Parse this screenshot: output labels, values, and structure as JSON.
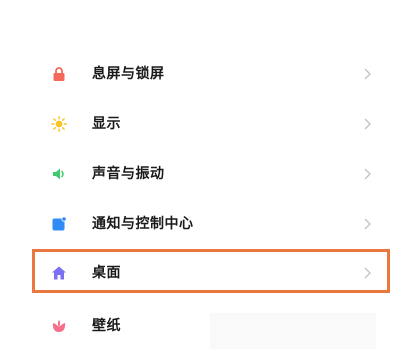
{
  "settings": {
    "items": [
      {
        "label": "息屏与锁屏",
        "icon": "lock-icon",
        "color": "#f4685a"
      },
      {
        "label": "显示",
        "icon": "sun-icon",
        "color": "#f9c425"
      },
      {
        "label": "声音与振动",
        "icon": "speaker-icon",
        "color": "#3ecb6f"
      },
      {
        "label": "通知与控制中心",
        "icon": "notification-icon",
        "color": "#2f8bf5"
      },
      {
        "label": "桌面",
        "icon": "home-icon",
        "color": "#7b6ff3"
      },
      {
        "label": "壁纸",
        "icon": "flower-icon",
        "color": "#f56f8d"
      }
    ],
    "highlighted_item": "桌面",
    "highlight_color": "#e9773e",
    "chevron_color": "#c4c4c4"
  }
}
